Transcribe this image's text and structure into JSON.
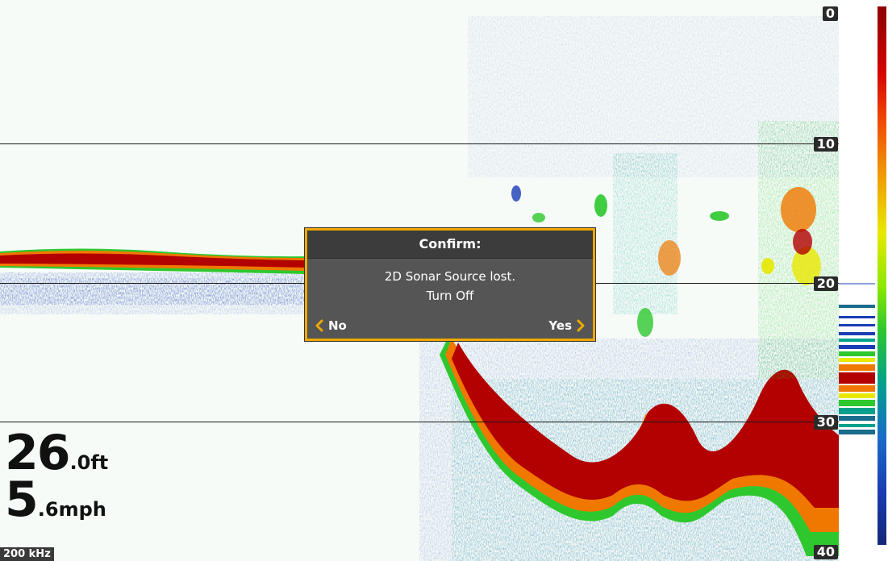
{
  "readout": {
    "depth_value": "26",
    "depth_unit": ".0ft",
    "speed_value": "5",
    "speed_unit": ".6mph"
  },
  "frequency": "200 kHz",
  "depth_scale": [
    "0",
    "10",
    "20",
    "30",
    "40"
  ],
  "dialog": {
    "title": "Confirm:",
    "message_line1": "2D Sonar Source lost.",
    "message_line2": "Turn Off",
    "no_label": "No",
    "yes_label": "Yes"
  },
  "colors": {
    "dialog_border": "#f0a800",
    "dialog_body": "#555555",
    "dialog_title_bg": "#3c3c3c",
    "sonar_red": "#b30000",
    "sonar_orange": "#f07800",
    "sonar_yellow": "#e8e800",
    "sonar_green": "#2ec82e",
    "sonar_teal": "#00a08c",
    "sonar_blue": "#1a3cb4"
  },
  "icons": {
    "no_button": "chevron-left-icon",
    "yes_button": "chevron-right-icon"
  }
}
